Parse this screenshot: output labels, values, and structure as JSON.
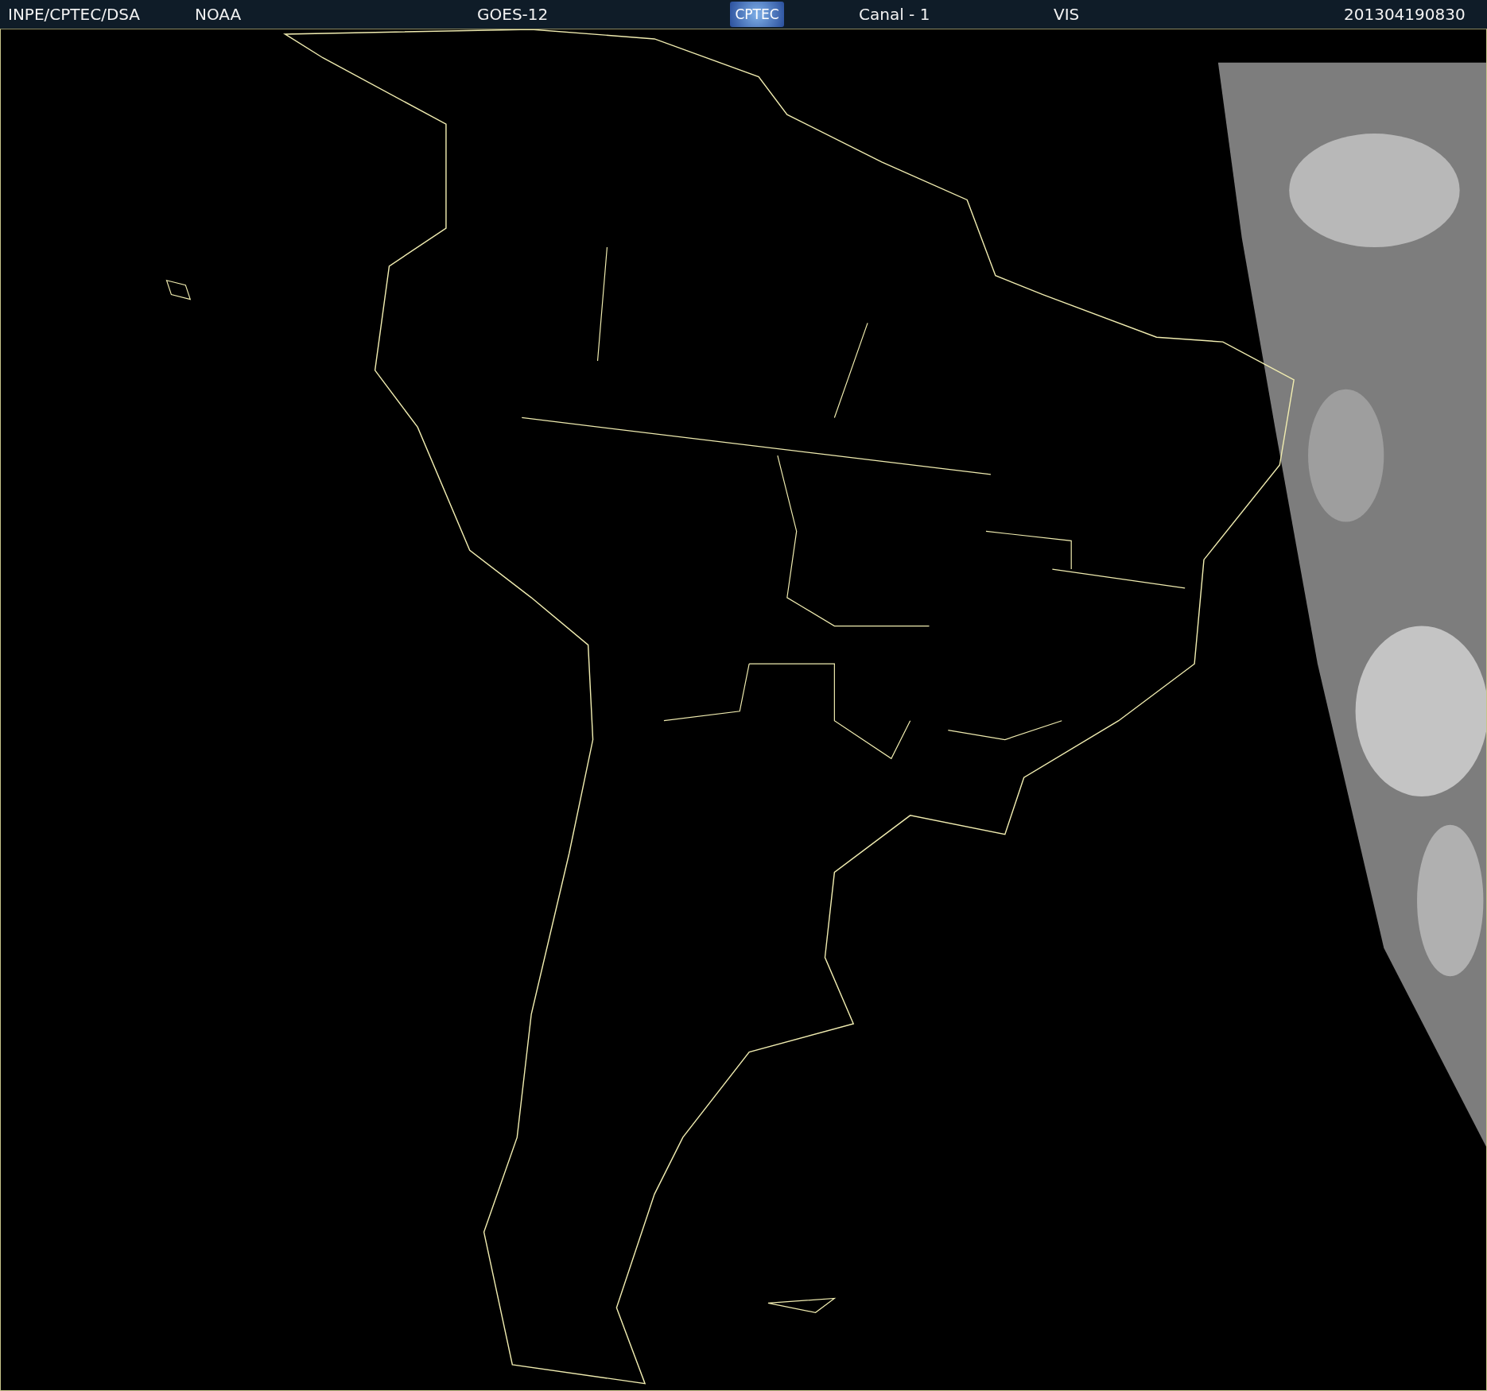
{
  "header": {
    "items": [
      {
        "kind": "text",
        "text": "INPE/CPTEC/DSA"
      },
      {
        "kind": "text",
        "text": "NOAA"
      },
      {
        "kind": "text",
        "text": "GOES-12"
      },
      {
        "kind": "logo",
        "text": "CPTEC"
      },
      {
        "kind": "text",
        "text": "Canal - 1"
      },
      {
        "kind": "text",
        "text": "VIS"
      },
      {
        "kind": "text",
        "text": "201304190830"
      }
    ]
  }
}
